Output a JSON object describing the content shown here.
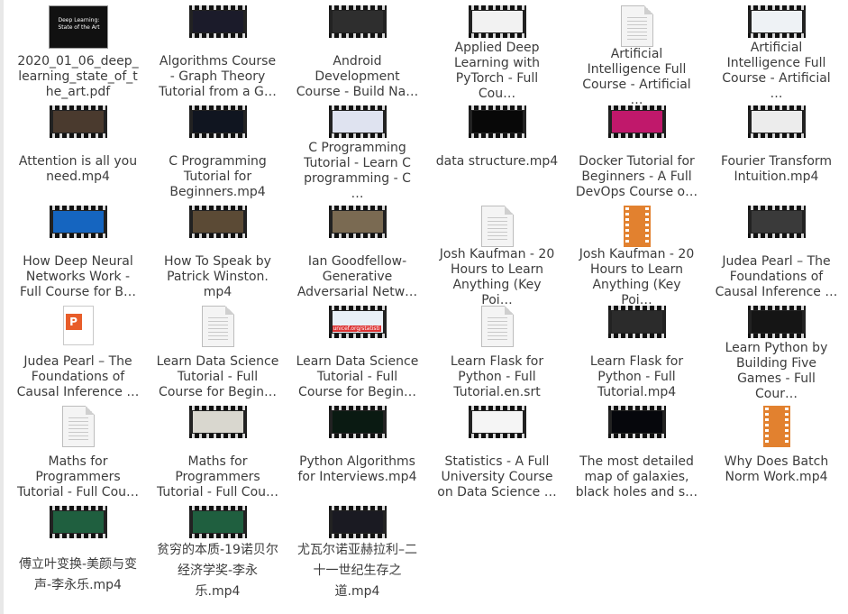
{
  "items": [
    {
      "label": "2020_01_06_deep_learning_state_of_the_art.pdf",
      "icon": "pdf-thumbnail-icon",
      "thumb_text": "Deep Learning: State of the Art"
    },
    {
      "label": "Algorithms Course - Graph Theory Tutorial from a G…",
      "icon": "video-thumbnail-icon",
      "screen": "#1b1b2a"
    },
    {
      "label": "Android Development Course - Build Na…",
      "icon": "video-thumbnail-icon",
      "screen": "#2e2e2e"
    },
    {
      "label": "Applied Deep Learning with PyTorch - Full Cou…",
      "icon": "video-thumbnail-icon",
      "screen": "#f2f2f2"
    },
    {
      "label": "Artificial Intelligence Full Course - Artificial …",
      "icon": "text-document-icon"
    },
    {
      "label": "Artificial Intelligence Full Course - Artificial …",
      "icon": "video-thumbnail-icon",
      "screen": "#eef2f5"
    },
    {
      "label": "Attention is all you need.mp4",
      "icon": "video-thumbnail-icon",
      "screen": "#4a3a2e"
    },
    {
      "label": "C Programming Tutorial for Beginners.mp4",
      "icon": "video-thumbnail-icon",
      "screen": "#101520"
    },
    {
      "label": "C Programming Tutorial - Learn C programming - C …",
      "icon": "video-thumbnail-icon",
      "screen": "#dfe3f0"
    },
    {
      "label": "data structure.mp4",
      "icon": "video-thumbnail-icon",
      "screen": "#080808"
    },
    {
      "label": "Docker Tutorial for Beginners - A Full DevOps Course o…",
      "icon": "video-thumbnail-icon",
      "screen": "#c0186b"
    },
    {
      "label": "Fourier Transform Intuition.mp4",
      "icon": "video-thumbnail-icon",
      "screen": "#ececec"
    },
    {
      "label": "How Deep Neural Networks Work - Full Course for B…",
      "icon": "video-thumbnail-icon",
      "screen": "#1565c0"
    },
    {
      "label": "How To Speak by Patrick Winston. mp4",
      "icon": "video-thumbnail-icon",
      "screen": "#5b4a35"
    },
    {
      "label": "Ian Goodfellow- Generative Adversarial Netw…",
      "icon": "video-thumbnail-icon",
      "screen": "#7a6a52"
    },
    {
      "label": "Josh Kaufman - 20 Hours to Learn Anything (Key Poi…",
      "icon": "text-document-icon"
    },
    {
      "label": "Josh Kaufman - 20 Hours to Learn Anything (Key Poi…",
      "icon": "vlc-video-icon"
    },
    {
      "label": "Judea Pearl – The Foundations of Causal Inference …",
      "icon": "video-thumbnail-icon",
      "screen": "#3a3a3a"
    },
    {
      "label": "Judea Pearl – The Foundations of Causal Inference …",
      "icon": "presentation-icon"
    },
    {
      "label": "Learn Data Science Tutorial - Full Course for Begin…",
      "icon": "text-document-icon"
    },
    {
      "label": "Learn Data Science Tutorial - Full Course for Begin…",
      "icon": "video-thumbnail-icon",
      "screen": "#e9f0f7",
      "overlay": "unicef.org/statisti"
    },
    {
      "label": "Learn Flask for Python - Full Tutorial.en.srt",
      "icon": "text-document-icon"
    },
    {
      "label": "Learn Flask for Python - Full Tutorial.mp4",
      "icon": "video-thumbnail-icon",
      "screen": "#2b2b2b"
    },
    {
      "label": "Learn Python by Building Five Games - Full Cour…",
      "icon": "video-thumbnail-icon",
      "screen": "#151515"
    },
    {
      "label": "Maths for Programmers Tutorial - Full Cou…",
      "icon": "text-document-icon"
    },
    {
      "label": "Maths for Programmers Tutorial - Full Cou…",
      "icon": "video-thumbnail-icon",
      "screen": "#d9d7cf"
    },
    {
      "label": "Python Algorithms for Interviews.mp4",
      "icon": "video-thumbnail-icon",
      "screen": "#0a1a12"
    },
    {
      "label": "Statistics - A Full University Course on Data Science …",
      "icon": "video-thumbnail-icon",
      "screen": "#f5f5f5"
    },
    {
      "label": "The most detailed map of galaxies, black holes and s…",
      "icon": "video-thumbnail-icon",
      "screen": "#06070c"
    },
    {
      "label": "Why Does Batch Norm Work.mp4",
      "icon": "vlc-video-icon"
    },
    {
      "label": "傅立叶变换-美颜与变声-李永乐.mp4",
      "icon": "video-thumbnail-icon",
      "screen": "#1f5f3f",
      "cjk": true
    },
    {
      "label": "贫穷的本质-19诺贝尔经济学奖-李永乐.mp4",
      "icon": "video-thumbnail-icon",
      "screen": "#1f5f3f",
      "cjk": true
    },
    {
      "label": "尤瓦尔诺亚赫拉利–二十一世纪生存之道.mp4",
      "icon": "video-thumbnail-icon",
      "screen": "#1a1a22",
      "cjk": true
    }
  ]
}
